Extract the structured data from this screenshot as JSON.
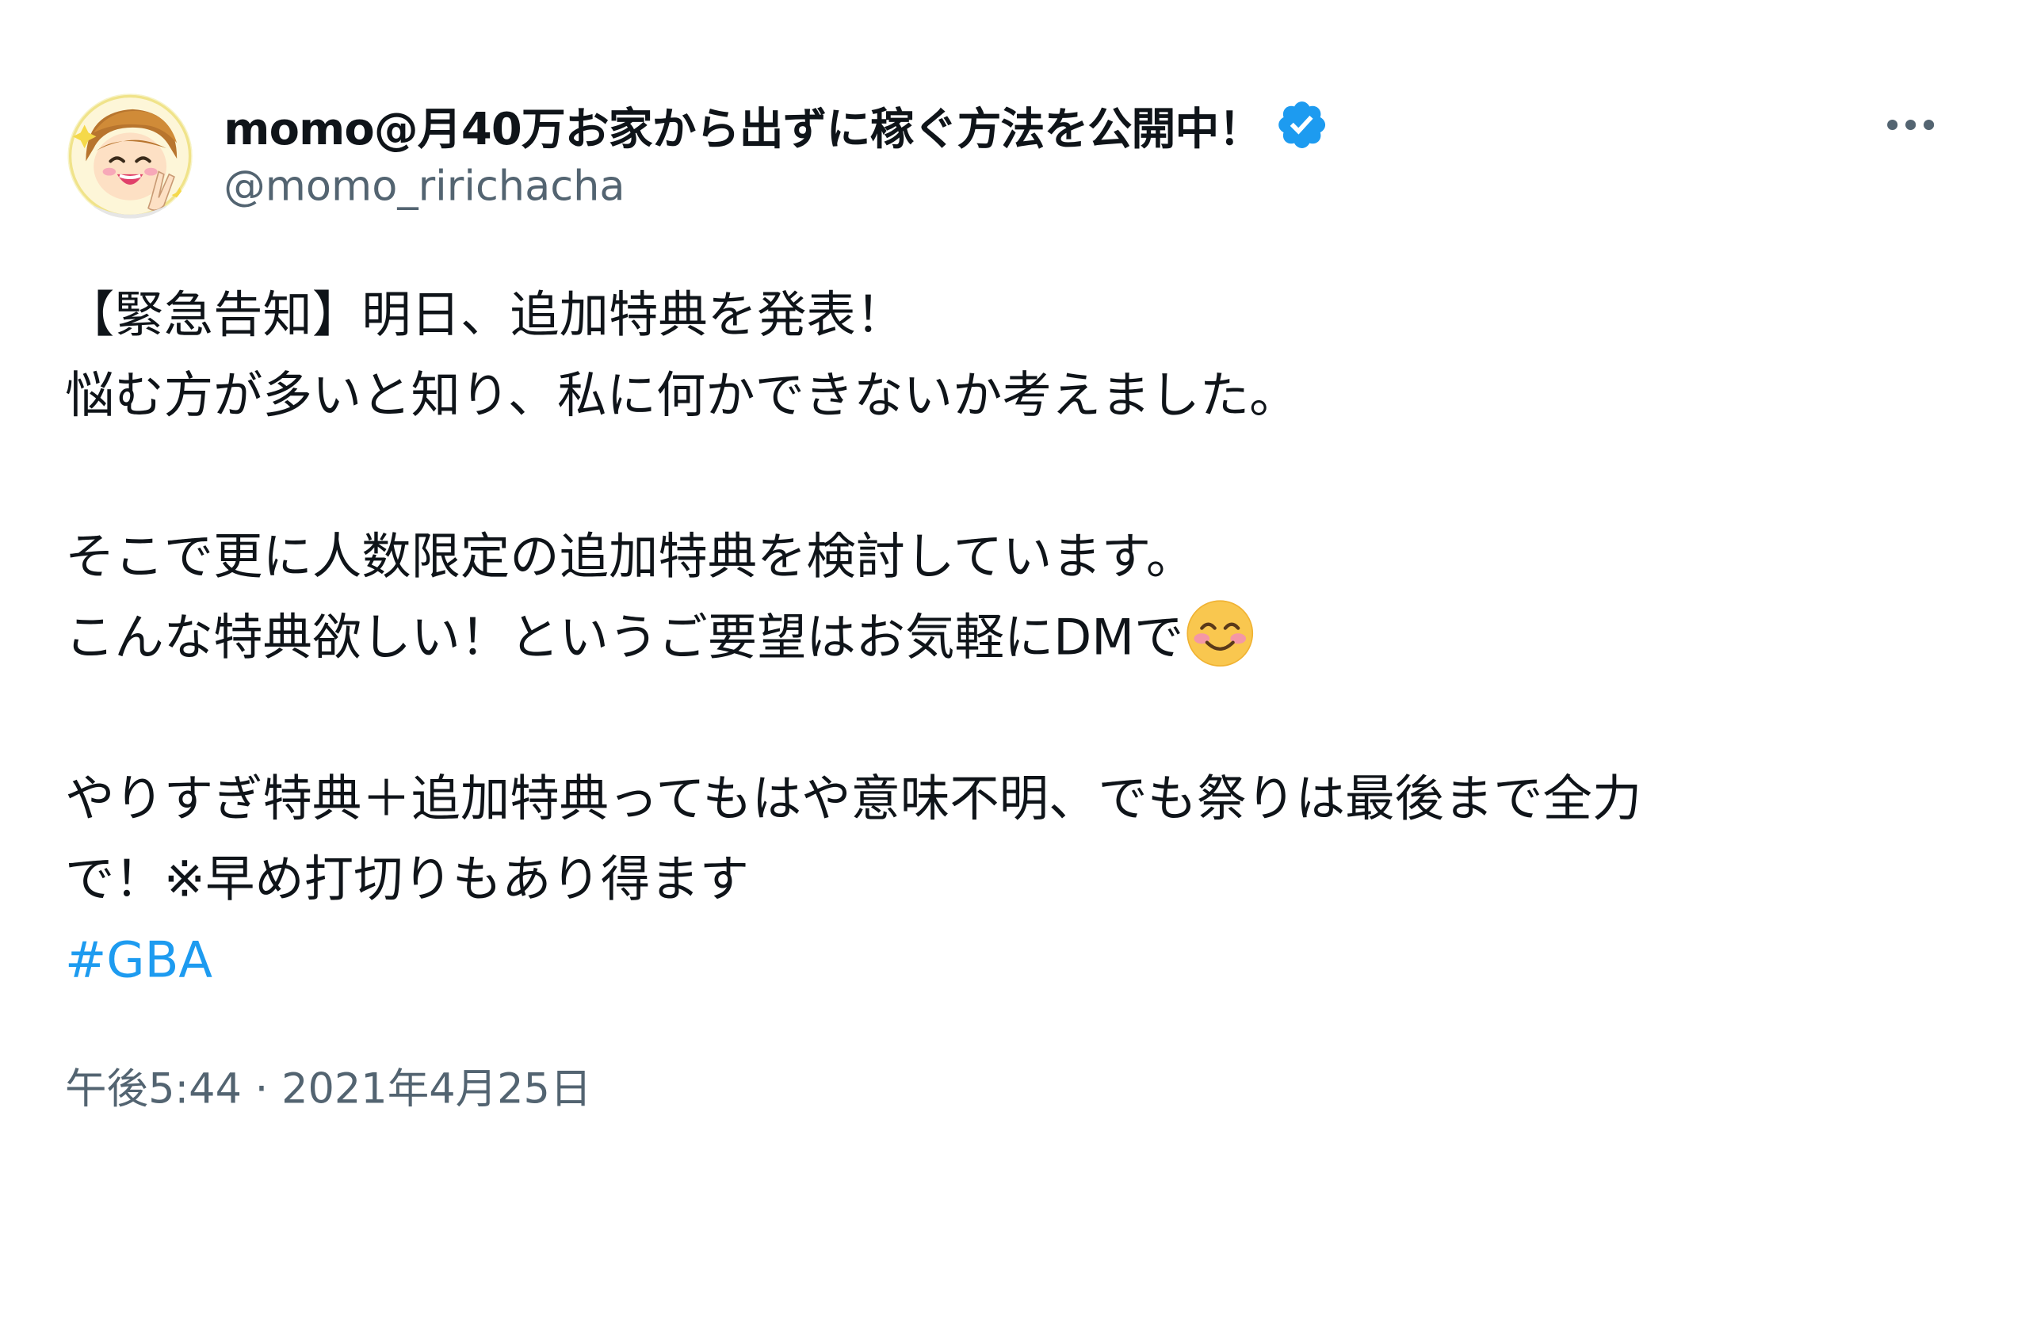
{
  "author": {
    "display_name": "momo@月40万お家から出ずに稼ぐ方法を公開中！",
    "handle": "@momo_ririchacha",
    "verified": true,
    "avatar_icon": "cartoon-avatar-icon"
  },
  "tweet": {
    "lines": [
      "【緊急告知】明日、追加特典を発表！",
      "悩む方が多いと知り、私に何かできないか考えました。",
      "",
      "そこで更に人数限定の追加特典を検討しています。",
      "こんな特典欲しい！というご要望はお気軽にDMで",
      "",
      "やりすぎ特典＋追加特典ってもはや意味不明、でも祭りは最後まで全力",
      "で！※早め打切りもあり得ます"
    ],
    "emoji": "smiling-face-with-smiling-eyes",
    "hashtag": "#GBA",
    "timestamp": "午後5:44 · 2021年4月25日"
  },
  "colors": {
    "text": "#0f1419",
    "secondary": "#536471",
    "accent": "#1d9bf0"
  }
}
